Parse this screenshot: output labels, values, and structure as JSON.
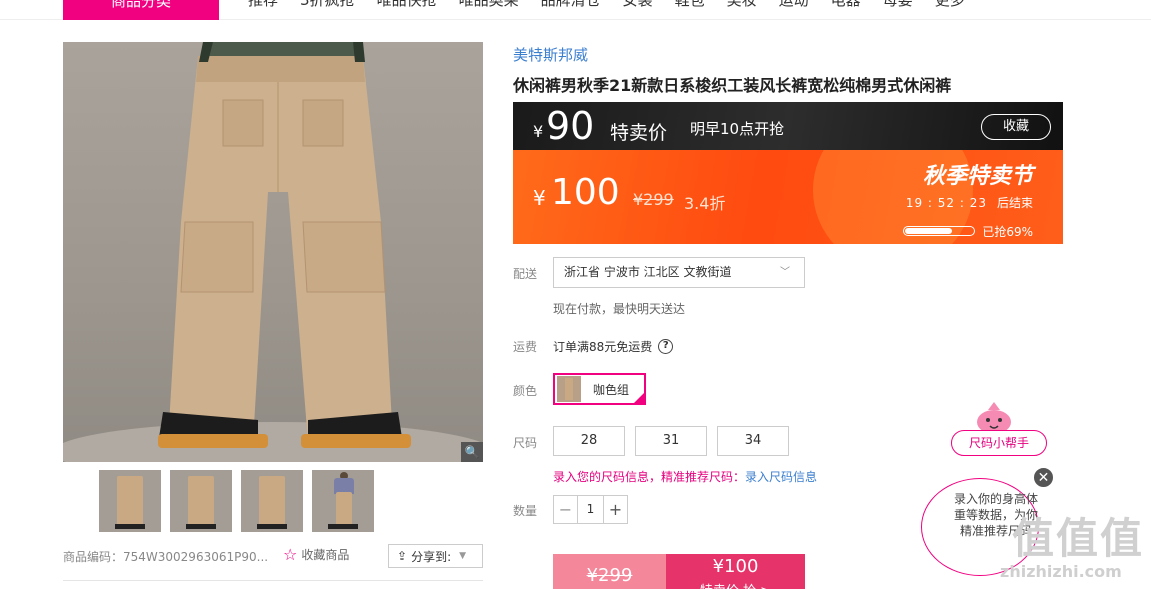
{
  "nav": {
    "category": "商品分类",
    "links": [
      "推荐",
      "3折疯抢",
      "唯品快抢",
      "唯品奥莱",
      "品牌清仓",
      "女装",
      "鞋包",
      "美妆",
      "运动",
      "电器",
      "母婴",
      "更多"
    ]
  },
  "gallery": {
    "product_code": "商品编码：754W3002963061P90...",
    "favorite": "收藏商品",
    "share": "分享到:"
  },
  "product": {
    "brand": "美特斯邦威",
    "title": "休闲裤男秋季21新款日系梭织工装风长裤宽松纯棉男式休闲裤"
  },
  "sale": {
    "currency": "¥",
    "special_price": "90",
    "special_label": "特卖价",
    "start_time": "明早10点开抢",
    "favorite_btn": "收藏",
    "current_price": "100",
    "original_price": "¥299",
    "discount": "3.4折",
    "festival": "秋季特卖节",
    "countdown": "19 : 52 : 23",
    "countdown_suffix": "后结束",
    "sold_text": "已抢69%",
    "sold_percent": 69
  },
  "delivery": {
    "label": "配送",
    "address": "浙江省 宁波市 江北区 文教街道",
    "note": "现在付款，最快明天送达"
  },
  "shipping": {
    "label": "运费",
    "text": "订单满88元免运费"
  },
  "color": {
    "label": "颜色",
    "selected": "咖色组"
  },
  "size": {
    "label": "尺码",
    "options": [
      "28",
      "31",
      "34"
    ],
    "tip": "录入您的尺码信息，精准推荐尺码：",
    "tip_link": "录入尺码信息"
  },
  "quantity": {
    "label": "数量",
    "value": "1"
  },
  "buy": {
    "original": "¥299",
    "price": "¥100",
    "action": "特卖价 抢 >"
  },
  "helper": {
    "title": "尺码小帮手",
    "text": "录入你的身高体重等数据，为你精准推荐尺码"
  },
  "watermark": {
    "glyphs": "值值值",
    "url": "zhizhizhi.com"
  }
}
